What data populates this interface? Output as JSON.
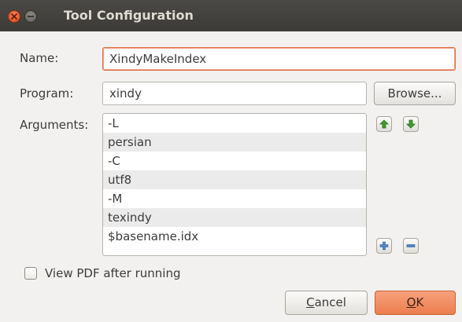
{
  "window": {
    "title": "Tool Configuration"
  },
  "form": {
    "name_label": "Name:",
    "name_value": "XindyMakeIndex",
    "program_label": "Program:",
    "program_value": "xindy",
    "browse_label": "Browse...",
    "arguments_label": "Arguments:",
    "arguments": [
      "-L",
      "persian",
      "-C",
      "utf8",
      "-M",
      "texindy",
      "$basename.idx"
    ],
    "view_pdf_label": "View PDF after running",
    "view_pdf_checked": false
  },
  "buttons": {
    "cancel_first": "C",
    "cancel_rest": "ancel",
    "ok_first": "O",
    "ok_rest": "K"
  },
  "icons": {
    "close": "close-icon",
    "minimize": "minimize-icon",
    "move_up": "arrow-up-icon",
    "move_down": "arrow-down-icon",
    "add": "plus-icon",
    "remove": "minus-icon"
  },
  "colors": {
    "titlebar": "#3c3b37",
    "accent": "#e26c3d",
    "ok_button": "#ec7d4e",
    "arrow_green": "#3e9c2a",
    "plusminus_blue": "#4c86c4"
  }
}
